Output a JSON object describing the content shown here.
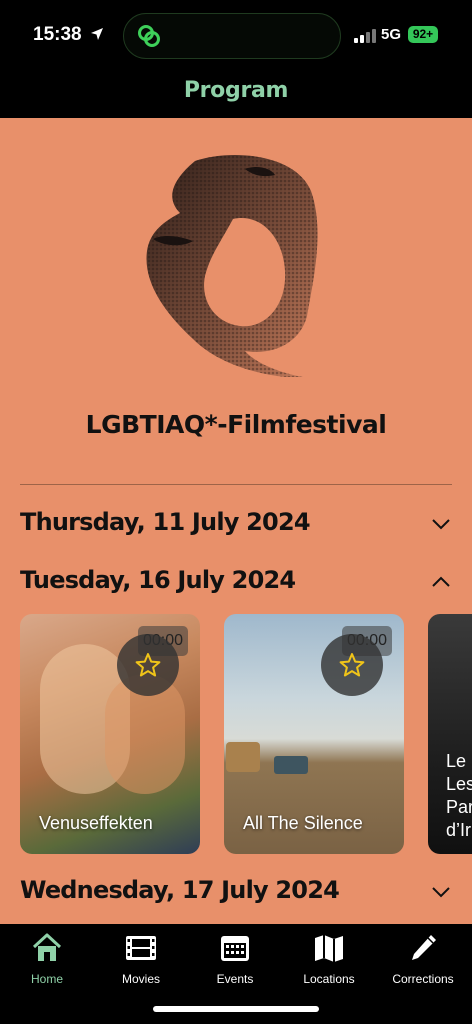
{
  "status_bar": {
    "time": "15:38",
    "network": "5G",
    "battery": "92+"
  },
  "header": {
    "title": "Program"
  },
  "festival": {
    "name": "LGBTIAQ*-Filmfestival"
  },
  "days": [
    {
      "label": "Thursday, 11 July 2024",
      "expanded": false
    },
    {
      "label": "Tuesday, 16 July 2024",
      "expanded": true
    },
    {
      "label": "Wednesday, 17 July 2024",
      "expanded": false
    }
  ],
  "events": [
    {
      "title": "Venuseffekten",
      "time": "00:00",
      "favorite_icon": "star-outline-icon"
    },
    {
      "title": "All The Silence",
      "time": "00:00",
      "favorite_icon": "star-outline-icon"
    },
    {
      "title_lines": [
        "Le",
        "Les",
        "Par",
        "d’Ir"
      ]
    }
  ],
  "tabs": [
    {
      "label": "Home",
      "icon": "home-icon",
      "active": true
    },
    {
      "label": "Movies",
      "icon": "film-icon",
      "active": false
    },
    {
      "label": "Events",
      "icon": "calendar-icon",
      "active": false
    },
    {
      "label": "Locations",
      "icon": "map-icon",
      "active": false
    },
    {
      "label": "Corrections",
      "icon": "pencil-icon",
      "active": false
    }
  ],
  "colors": {
    "background": "#e8906a",
    "accent": "#8fd1a8",
    "star": "#f0c419",
    "bar": "#000000"
  }
}
